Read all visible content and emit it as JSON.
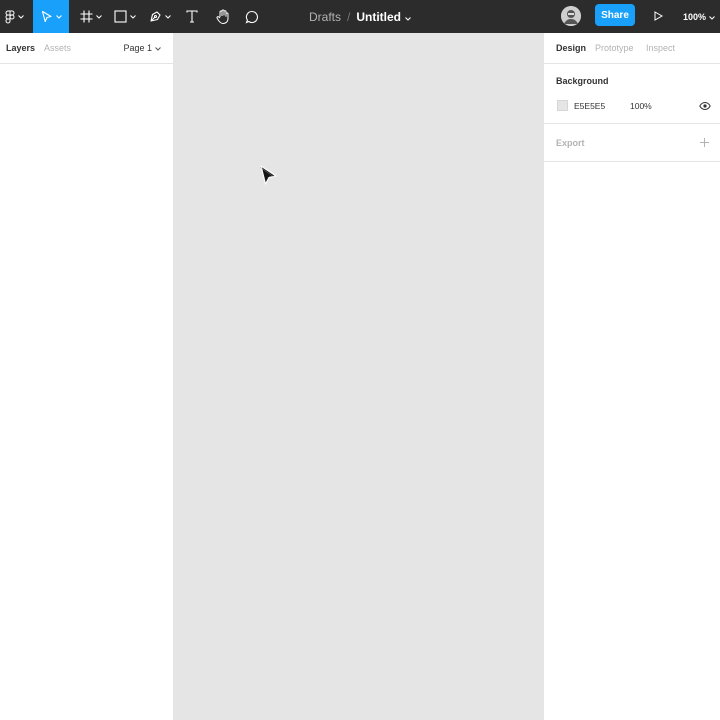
{
  "toolbar": {
    "main_menu_icon": "figma-logo-icon",
    "tools": [
      {
        "name": "move-tool",
        "icon": "move-arrow-icon",
        "active": true
      },
      {
        "name": "frame-tool",
        "icon": "frame-hash-icon",
        "active": false
      },
      {
        "name": "shape-tool",
        "icon": "rectangle-icon",
        "active": false
      },
      {
        "name": "pen-tool",
        "icon": "pen-nib-icon",
        "active": false
      },
      {
        "name": "text-tool",
        "icon": "text-t-icon",
        "active": false
      },
      {
        "name": "hand-tool",
        "icon": "hand-icon",
        "active": false
      },
      {
        "name": "comment-tool",
        "icon": "speech-bubble-icon",
        "active": false
      }
    ],
    "breadcrumb_folder": "Drafts",
    "breadcrumb_separator": "/",
    "file_name": "Untitled",
    "share_label": "Share",
    "zoom_label": "100%"
  },
  "left_panel": {
    "tabs": {
      "layers": "Layers",
      "assets": "Assets"
    },
    "page_label": "Page 1"
  },
  "right_panel": {
    "tabs": {
      "design": "Design",
      "prototype": "Prototype",
      "inspect": "Inspect"
    },
    "background": {
      "title": "Background",
      "hex": "E5E5E5",
      "opacity": "100%"
    },
    "export": {
      "title": "Export"
    }
  },
  "colors": {
    "toolbar_bg": "#2c2c2c",
    "accent": "#18a0fb",
    "canvas_bg": "#e5e5e5",
    "panel_bg": "#ffffff"
  }
}
